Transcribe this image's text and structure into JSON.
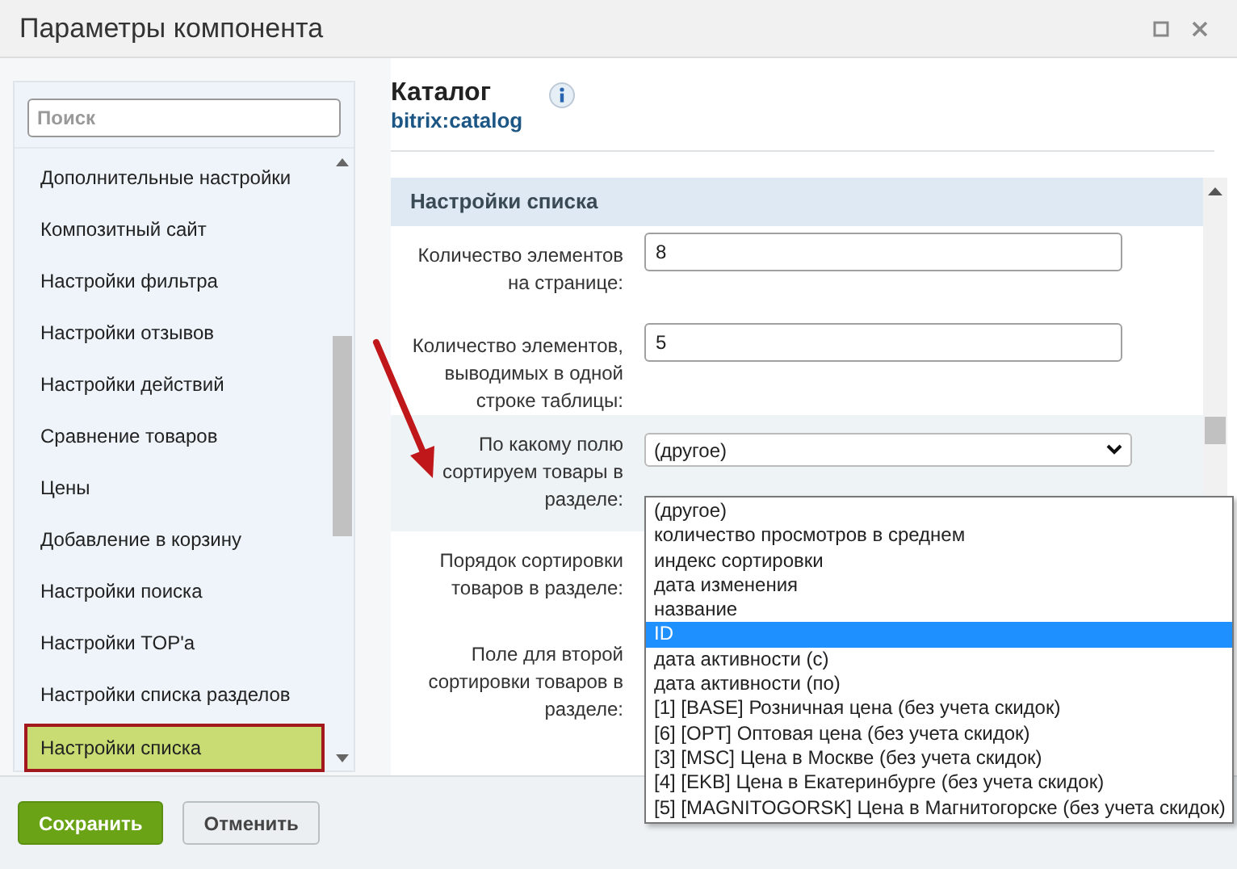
{
  "window": {
    "title": "Параметры компонента"
  },
  "sidebar": {
    "search": {
      "placeholder": "Поиск"
    },
    "items": [
      {
        "label": "Дополнительные настройки",
        "selected": false
      },
      {
        "label": "Композитный сайт",
        "selected": false
      },
      {
        "label": "Настройки фильтра",
        "selected": false
      },
      {
        "label": "Настройки отзывов",
        "selected": false
      },
      {
        "label": "Настройки действий",
        "selected": false
      },
      {
        "label": "Сравнение товаров",
        "selected": false
      },
      {
        "label": "Цены",
        "selected": false
      },
      {
        "label": "Добавление в корзину",
        "selected": false
      },
      {
        "label": "Настройки поиска",
        "selected": false
      },
      {
        "label": "Настройки TOP'a",
        "selected": false
      },
      {
        "label": "Настройки списка разделов",
        "selected": false
      },
      {
        "label": "Настройки списка",
        "selected": true
      }
    ]
  },
  "component": {
    "name": "Каталог",
    "code": "bitrix:catalog"
  },
  "section": {
    "title": "Настройки списка",
    "fields": [
      {
        "kind": "input",
        "label": "Количество элементов на странице:",
        "value": "8"
      },
      {
        "kind": "input",
        "label": "Количество элементов, выводимых в одной строке таблицы:",
        "value": "5"
      },
      {
        "kind": "select",
        "label": "По какому полю сортируем товары в разделе:",
        "value": "(другое)",
        "options": [
          {
            "label": "(другое)",
            "highlighted": false
          },
          {
            "label": "количество просмотров в среднем",
            "highlighted": false
          },
          {
            "label": "индекс сортировки",
            "highlighted": false
          },
          {
            "label": "дата изменения",
            "highlighted": false
          },
          {
            "label": "название",
            "highlighted": false
          },
          {
            "label": "ID",
            "highlighted": true
          },
          {
            "label": "дата активности (с)",
            "highlighted": false
          },
          {
            "label": "дата активности (по)",
            "highlighted": false
          },
          {
            "label": "[1] [BASE] Розничная цена (без учета скидок)",
            "highlighted": false
          },
          {
            "label": "[6] [OPT] Оптовая цена (без учета скидок)",
            "highlighted": false
          },
          {
            "label": "[3] [MSC] Цена в Москве (без учета скидок)",
            "highlighted": false
          },
          {
            "label": "[4] [EKB] Цена в Екатеринбурге (без учета скидок)",
            "highlighted": false
          },
          {
            "label": "[5] [MAGNITOGORSK] Цена в Магнитогорске (без учета скидок)",
            "highlighted": false
          }
        ]
      },
      {
        "kind": "covered",
        "label": "Порядок сортировки товаров в разделе:"
      },
      {
        "kind": "covered",
        "label": "Поле для второй сортировки товаров в разделе:"
      }
    ]
  },
  "buttons": [
    {
      "label": "Сохранить",
      "kind": "primary"
    },
    {
      "label": "Отменить",
      "kind": "secondary"
    }
  ]
}
